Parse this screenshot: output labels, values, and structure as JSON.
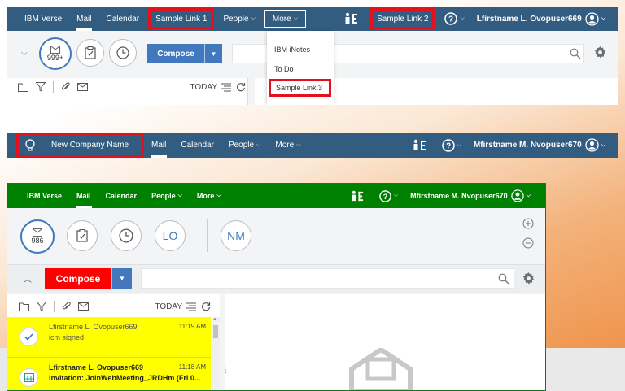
{
  "panel1": {
    "nav": {
      "brand": "IBM Verse",
      "mail": "Mail",
      "calendar": "Calendar",
      "sample1": "Sample Link 1",
      "people": "People",
      "more": "More",
      "sample2": "Sample Link 2",
      "user": "Lfirstname L. Ovopuser669"
    },
    "unread_count": "999+",
    "compose_label": "Compose",
    "today_label": "TODAY",
    "more_menu": [
      "IBM iNotes",
      "To Do",
      "Sample Link 3"
    ]
  },
  "panel2": {
    "nav": {
      "company": "New Company Name",
      "mail": "Mail",
      "calendar": "Calendar",
      "people": "People",
      "more": "More",
      "user": "Mfirstname M. Nvopuser670"
    }
  },
  "panel3": {
    "nav": {
      "brand": "IBM Verse",
      "mail": "Mail",
      "calendar": "Calendar",
      "people": "People",
      "more": "More",
      "user": "Mfirstname M. Nvopuser670"
    },
    "unread_count": "986",
    "avatar_lo": "LO",
    "avatar_nm": "NM",
    "compose_label": "Compose",
    "today_label": "TODAY",
    "messages": [
      {
        "sender": "Lfirstname L. Ovopuser669",
        "time": "11:19 AM",
        "subject": "icm signed"
      },
      {
        "sender": "Lfirstname L. Ovopuser669",
        "time": "11:18 AM",
        "subject": "Invitation: JoinWebMeeting_JRDHm (Fri 0..."
      }
    ]
  },
  "colors": {
    "nav_blue": "#325c80",
    "nav_green": "#008000",
    "compose_blue": "#4178be",
    "compose_red": "#ff0000",
    "highlight_red": "#e3101e",
    "message_yellow": "#ffff00"
  }
}
